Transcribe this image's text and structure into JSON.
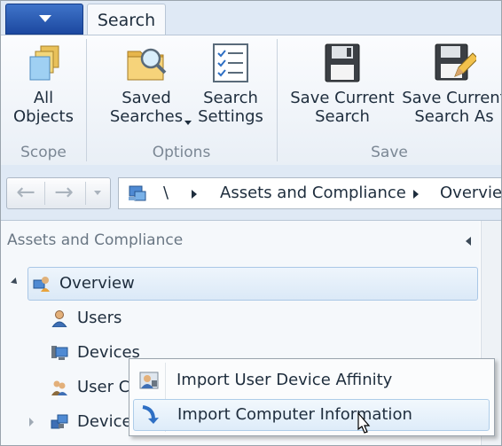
{
  "ribbon": {
    "tabs": [
      {
        "label": "Search"
      }
    ],
    "groups": {
      "scope": {
        "label": "Scope",
        "all_objects": "All\nObjects"
      },
      "options": {
        "label": "Options",
        "saved_searches": "Saved\nSearches",
        "search_settings": "Search\nSettings"
      },
      "save": {
        "label": "Save",
        "save_current": "Save Current\nSearch",
        "save_current_as": "Save Current\nSearch As"
      }
    }
  },
  "address_bar": {
    "back_icon": "left-arrow",
    "forward_icon": "right-arrow",
    "crumbs": [
      "\\",
      "Assets and Compliance",
      "Overview"
    ]
  },
  "nav_pane": {
    "title": "Assets and Compliance",
    "tree": [
      {
        "label": "Overview",
        "icon": "overview-icon",
        "selected": true
      },
      {
        "label": "Users",
        "icon": "user-icon"
      },
      {
        "label": "Devices",
        "icon": "devices-icon"
      },
      {
        "label": "User Co",
        "icon": "user-collections-icon"
      },
      {
        "label": "Device",
        "icon": "device-collections-icon"
      }
    ]
  },
  "context_menu": {
    "items": [
      {
        "label": "Import User Device Affinity",
        "icon": "import-affinity-icon"
      },
      {
        "label": "Import Computer Information",
        "icon": "import-computer-icon",
        "hover": true
      }
    ]
  },
  "colors": {
    "app_menu": "#2a59b5",
    "tab_strip": "#dfe9f5",
    "selection": "#dbe9f7"
  }
}
